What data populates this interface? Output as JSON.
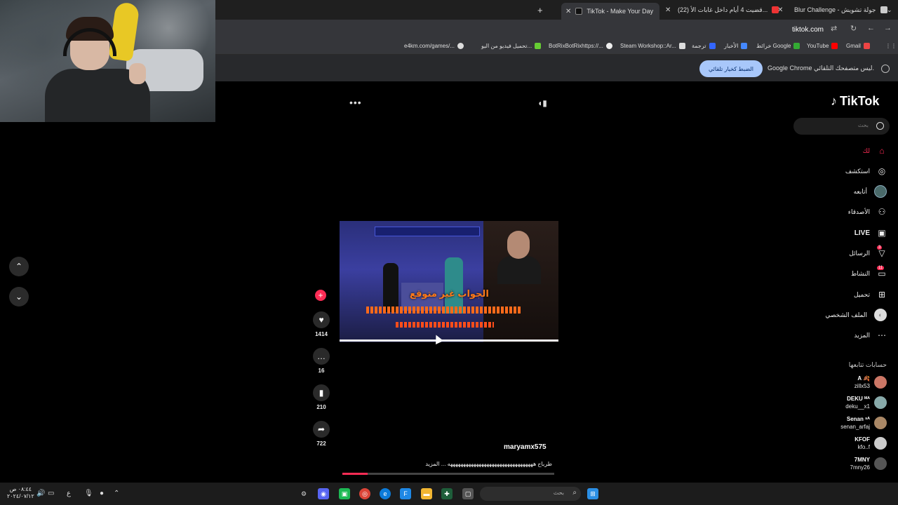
{
  "browser": {
    "tabs": [
      {
        "label": "Blur Challenge - جولة تشويش",
        "active": false
      },
      {
        "label": "(22) قضيت 4 أيام داخل غابات الأ...",
        "active": false
      },
      {
        "label": "TikTok - Make Your Day",
        "active": true
      }
    ],
    "address": "tiktok.com",
    "bookmarks": [
      "Gmail",
      "YouTube",
      "خرائط Google",
      "الأخبار",
      "ترجمة",
      "Steam Workshop::Ar...",
      "BotRixBotRixhttps://...",
      "تحميل فيديو من اليو...",
      "e4km.com/games/..."
    ],
    "infobar": {
      "message": "Google Chrome ليس متصفحك التلقائي.",
      "button": "الضبط كخيار تلقائي"
    }
  },
  "tiktok": {
    "logo": "TikTok",
    "search_placeholder": "بحث",
    "nav": [
      {
        "label": "لك",
        "icon": "home-icon",
        "active": true
      },
      {
        "label": "استكشف",
        "icon": "compass-icon"
      },
      {
        "label": "أتابعه",
        "icon": "following-avatar-icon"
      },
      {
        "label": "الأصدقاء",
        "icon": "friends-icon"
      },
      {
        "label": "LIVE",
        "icon": "live-tv-icon"
      },
      {
        "label": "الرسائل",
        "icon": "messages-icon",
        "badge": "3"
      },
      {
        "label": "النشاط",
        "icon": "activity-icon",
        "badge": "11"
      },
      {
        "label": "تحميل",
        "icon": "upload-icon"
      },
      {
        "label": "الملف الشخصي",
        "icon": "profile-icon"
      },
      {
        "label": "المزيد",
        "icon": "more-icon"
      }
    ],
    "following_title": "حسابات تتابعها",
    "following": [
      {
        "display": "A 🍂",
        "handle": "zillx53"
      },
      {
        "display": "DEKU ᴹᴬ",
        "handle": "deku__x1"
      },
      {
        "display": "Senan ˢᴬ",
        "handle": "senan_arfaj"
      },
      {
        "display": "KFOF",
        "handle": "kfo..f"
      },
      {
        "display": "7MNY",
        "handle": "7mny26"
      }
    ]
  },
  "video": {
    "overlay_caption": "الجواب غير متوقع",
    "username": "maryamx575",
    "caption": "طرباح هههههههههههههههههههههههههههههههههه ... المزيد",
    "progress_fraction": 0.12,
    "stats": {
      "likes": "1414",
      "comments": "16",
      "saves": "210",
      "shares": "722"
    }
  },
  "taskbar": {
    "clock_time": "٠٨:٤٤ ص",
    "clock_date": "٢٠٢٤/٠٧/١٢",
    "search_placeholder": "بحث",
    "lang": "ع"
  },
  "colors": {
    "tiktok_red": "#fe2c55",
    "caption_orange": "#ff7a1a",
    "chrome_button": "#a8c7fa"
  }
}
